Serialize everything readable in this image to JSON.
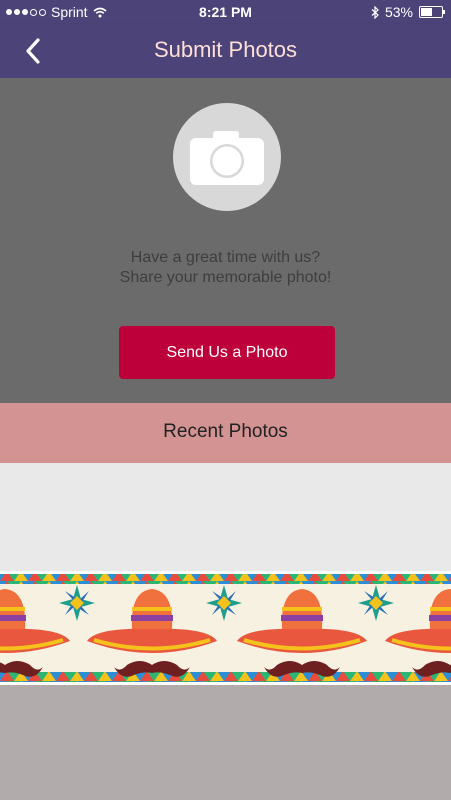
{
  "status_bar": {
    "carrier": "Sprint",
    "time": "8:21 PM",
    "battery": "53%",
    "battery_level": 0.53,
    "signal_bars": 3
  },
  "nav": {
    "title": "Submit Photos",
    "back_icon": "chevron-left-icon"
  },
  "hero": {
    "icon": "camera-icon",
    "line1": "Have a great time with us?",
    "line2": "Share your memorable photo!",
    "button_label": "Send Us a Photo"
  },
  "recent": {
    "title": "Recent Photos"
  },
  "colors": {
    "nav_bg": "#4c4379",
    "hero_bg": "#6b6b6b",
    "button_bg": "#be003a",
    "recent_header_bg": "#d29392"
  }
}
